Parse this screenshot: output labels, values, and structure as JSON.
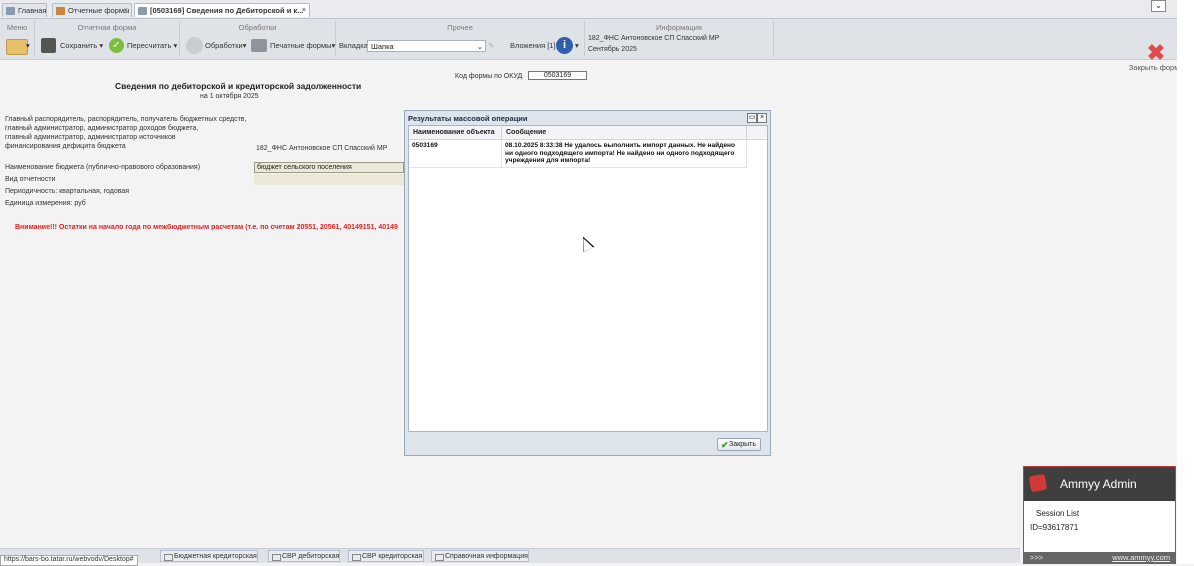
{
  "tabs": [
    {
      "label": "Главная"
    },
    {
      "label": "Отчетные формы"
    },
    {
      "label": "[0503169] Сведения по Дебиторской и к..."
    }
  ],
  "toolbar": {
    "groups": {
      "menu": "Меню",
      "report_form": "Отчетная форма",
      "processing": "Обработки",
      "other": "Прочее",
      "info": "Информация"
    },
    "save_label": "Сохранить",
    "recalc_label": "Пересчитать",
    "processing_label": "Обработки",
    "print_label": "Печатные формы",
    "tab_label": "Вкладка",
    "tab_value": "Шапка",
    "attachments_label": "Вложения [1]",
    "info_line1": "182_ФНС Антоновское СП Спасский МР",
    "info_line2": "Сентябрь 2025",
    "close_form_label": "Закрыть форму"
  },
  "document": {
    "title": "Сведения по дебиторской и кредиторской задолженности",
    "date_line": "на 1 октября 2025",
    "okud_label": "Код формы по ОКУД",
    "okud_value": "0503169",
    "admin_label_1": "Главный распорядитель, распорядитель, получатель бюджетных средств,",
    "admin_label_2": "главный администратор, администратор доходов бюджета,",
    "admin_label_3": "главный администратор, администратор источников",
    "admin_label_4": "финансирования дефицита бюджета",
    "admin_value": "182_ФНС Антоновское СП Спасский МР",
    "budget_label": "Наименование бюджета (публично-правового образования)",
    "budget_value": "бюджет сельского поселения",
    "report_type_label": "Вид отчетности",
    "periodicity_label": "Периодичность: квартальная, годовая",
    "unit_label": "Единица измерения: руб",
    "warning": "Внимание!!! Остатки на начало года по межбюджетным расчетам (т.е. по счетам 20551, 20561, 40149151, 40149"
  },
  "dialog": {
    "title": "Результаты массовой операции",
    "col_object": "Наименование объекта",
    "col_message": "Сообщение",
    "rows": [
      {
        "object": "0503169",
        "message": "08.10.2025 8:33:38 Не удалось выполнить импорт данных. Не найдено ни одного подходящего импорта! Не найдено ни одного подходящего учреждения для импорта!"
      }
    ],
    "close_label": "Закрыть"
  },
  "ammyy": {
    "title": "Ammyy Admin",
    "session_list": "Session List",
    "id_line": "ID=93617871",
    "footer_left": ">>>",
    "footer_link": "www.ammyy.com"
  },
  "bottom_tabs": [
    {
      "label": "Бюджетная кредиторская"
    },
    {
      "label": "СВР дебиторская"
    },
    {
      "label": "СВР кредиторская"
    },
    {
      "label": "Справочная информация"
    }
  ],
  "status_url": "https://bars-bo.tatar.ru/webvodv/Desktop#"
}
